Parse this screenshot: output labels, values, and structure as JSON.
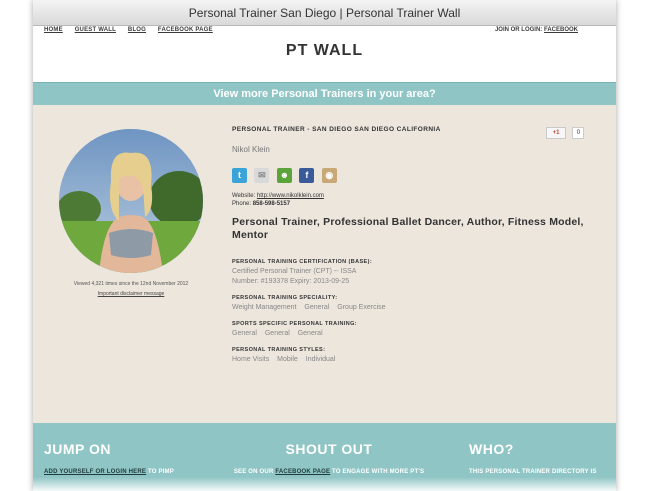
{
  "window": {
    "title": "Personal Trainer San Diego | Personal Trainer Wall"
  },
  "nav": {
    "items": [
      "HOME",
      "GUEST WALL",
      "BLOG",
      "FACEBOOK PAGE"
    ],
    "join_text": "JOIN OR LOGIN:",
    "join_link": "FACEBOOK"
  },
  "logo": "PT WALL",
  "banner": "View more Personal Trainers in your area?",
  "profile": {
    "headline": "PERSONAL TRAINER - SAN DIEGO SAN DIEGO CALIFORNIA",
    "name": "Nikol Klein",
    "gplus_label": "+1",
    "gplus_count": "0",
    "social_icons": [
      "twitter-icon",
      "email-icon",
      "contact-icon",
      "facebook-icon",
      "instagram-icon"
    ],
    "website_label": "Website:",
    "website_url": "http://www.nikolklein.com",
    "phone_label": "Phone:",
    "phone": "858-598-5157",
    "tagline": "Personal Trainer, Professional Ballet Dancer, Author, Fitness Model, Mentor",
    "viewed": "Viewed 4,321 times since the 12nd November 2012",
    "disclaimer": "Important disclaimer message"
  },
  "sections": [
    {
      "title": "PERSONAL TRAINING CERTIFICATION (BASE):",
      "lines": [
        "Certified Personal Trainer (CPT) -- ISSA",
        "Number: #193378 Expiry: 2013-09-25"
      ]
    },
    {
      "title": "PERSONAL TRAINING SPECIALITY:",
      "items": [
        "Weight Management",
        "General",
        "Group Exercise"
      ]
    },
    {
      "title": "SPORTS SPECIFIC PERSONAL TRAINING:",
      "items": [
        "General",
        "General",
        "General"
      ]
    },
    {
      "title": "PERSONAL TRAINING STYLES:",
      "items": [
        "Home Visits",
        "Mobile",
        "Individual"
      ]
    }
  ],
  "footer": {
    "col1": {
      "title": "JUMP ON",
      "link": "ADD YOURSELF OR LOGIN HERE",
      "text": " TO PIMP"
    },
    "col2": {
      "title": "SHOUT OUT",
      "pre": "SEE ON OUR ",
      "link": "FACEBOOK PAGE",
      "post": " TO ENGAGE WITH MORE PT'S"
    },
    "col3": {
      "title": "WHO?",
      "text": "THIS PERSONAL TRAINER DIRECTORY IS"
    }
  },
  "colors": {
    "teal": "#8fc5c4",
    "beige": "#ece6dd"
  }
}
